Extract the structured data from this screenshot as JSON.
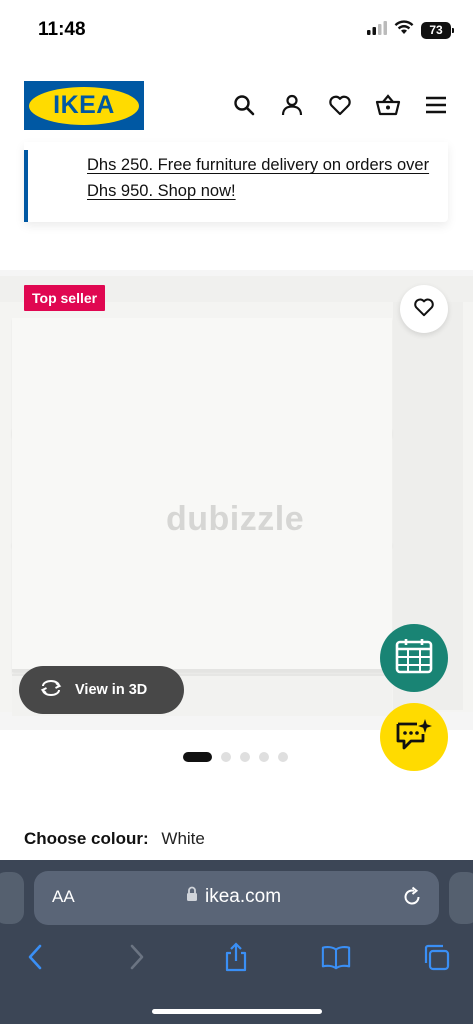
{
  "status_bar": {
    "time": "11:48",
    "battery": "73",
    "icons": [
      "cellular-signal-icon",
      "wifi-icon",
      "battery-icon"
    ]
  },
  "header": {
    "logo_text": "IKEA",
    "icons": [
      "search-icon",
      "account-icon",
      "heart-icon",
      "basket-icon",
      "menu-icon"
    ]
  },
  "banner": {
    "text": "Dhs 250. Free furniture delivery on orders over Dhs 950. Shop now!"
  },
  "product": {
    "badge": "Top seller",
    "watermark": "dubizzle",
    "view_3d_label": "View in 3D",
    "image_count": 5,
    "active_image_index": 0
  },
  "colour": {
    "label": "Choose colour:",
    "value": "White"
  },
  "browser": {
    "aa_label": "AA",
    "url": "ikea.com",
    "toolbar_icons": [
      "back-icon",
      "forward-icon",
      "share-icon",
      "bookmarks-icon",
      "tabs-icon"
    ]
  },
  "colors": {
    "ikea_blue": "#0058a3",
    "ikea_yellow": "#ffdb00",
    "top_seller_red": "#e00751",
    "calendar_green": "#198474",
    "safari_bar": "#3c4656"
  }
}
